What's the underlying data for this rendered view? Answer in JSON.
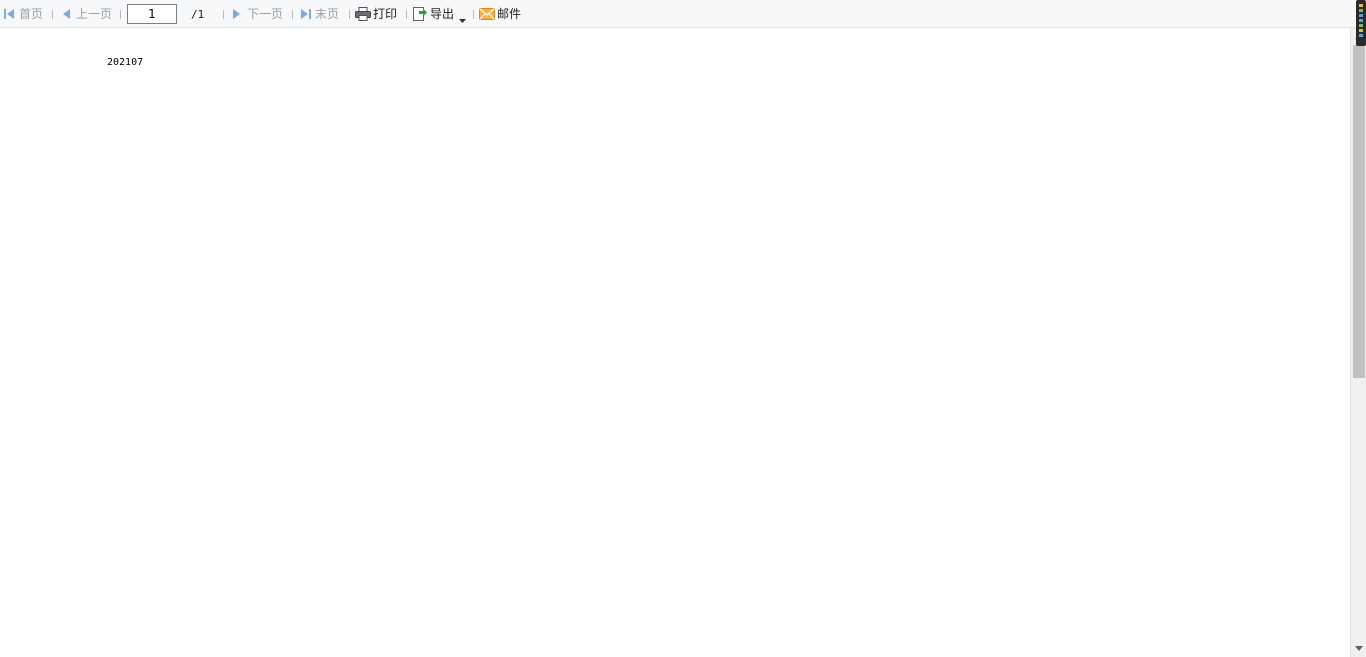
{
  "toolbar": {
    "first_label": "首页",
    "prev_label": "上一页",
    "page_input_value": "1",
    "page_total": "/1",
    "next_label": "下一页",
    "last_label": "末页",
    "print_label": "打印",
    "export_label": "导出",
    "mail_label": "邮件"
  },
  "report": {
    "value": "202107"
  },
  "colors": {
    "nav_arrow": "#4a90d9",
    "export_green": "#2e9e4a",
    "mail_orange": "#f0a030"
  }
}
